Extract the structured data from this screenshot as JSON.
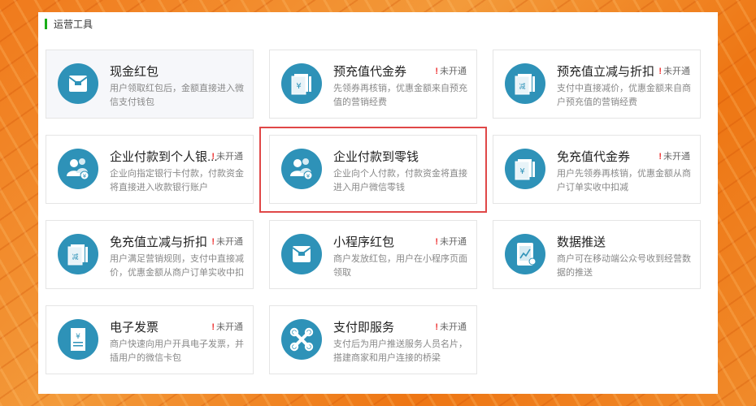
{
  "section": {
    "title": "运营工具"
  },
  "status_label": "未开通",
  "status_mark": "!",
  "cards": [
    {
      "title": "现金红包",
      "desc": "用户领取红包后，金额直接进入微信支付钱包",
      "icon": "red-packet-icon",
      "enabled": true
    },
    {
      "title": "预充值代金券",
      "desc": "先领券再核销，优惠金额来自预充值的营销经费",
      "icon": "voucher-icon",
      "enabled": false
    },
    {
      "title": "预充值立减与折扣",
      "desc": "支付中直接减价，优惠金额来自商户预充值的营销经费",
      "icon": "discount-icon",
      "enabled": false
    },
    {
      "title": "企业付款到个人银...",
      "desc": "企业向指定银行卡付款，付款资金将直接进入收款银行账户",
      "icon": "people-payment-icon",
      "enabled": false
    },
    {
      "title": "企业付款到零钱",
      "desc": "企业向个人付款，付款资金将直接进入用户微信零钱",
      "icon": "people-payment-icon",
      "enabled": true
    },
    {
      "title": "免充值代金券",
      "desc": "用户先领券再核销，优惠金额从商户订单实收中扣减",
      "icon": "voucher-icon",
      "enabled": false
    },
    {
      "title": "免充值立减与折扣",
      "desc": "用户满足营销规则，支付中直接减价，优惠金额从商户订单实收中扣",
      "icon": "discount-icon",
      "enabled": false
    },
    {
      "title": "小程序红包",
      "desc": "商户发放红包，用户在小程序页面领取",
      "icon": "red-packet-icon",
      "enabled": false
    },
    {
      "title": "数据推送",
      "desc": "商户可在移动端公众号收到经营数据的推送",
      "icon": "tablet-chart-icon",
      "enabled": true
    },
    {
      "title": "电子发票",
      "desc": "商户快速向用户开具电子发票，并插用户的微信卡包",
      "icon": "invoice-icon",
      "enabled": false
    },
    {
      "title": "支付即服务",
      "desc": "支付后为用户推送服务人员名片，搭建商家和用户连接的桥梁",
      "icon": "link-service-icon",
      "enabled": false
    }
  ],
  "colors": {
    "icon_bg": "#2e92b8",
    "accent_green": "#1aad19",
    "highlight_red": "#e04848",
    "background_orange": "#f07a1c"
  }
}
